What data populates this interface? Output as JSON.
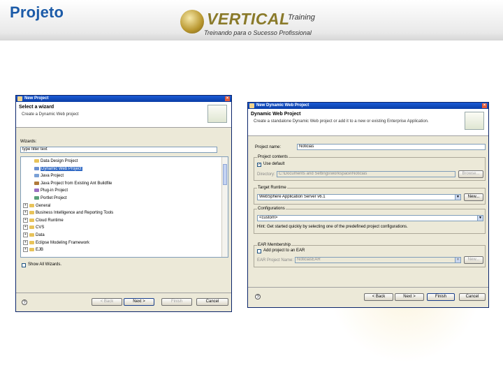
{
  "slide": {
    "title": "Projeto",
    "logo": {
      "brand": "ERTICAL",
      "brand_prefix": "V",
      "brand_suffix": "Training",
      "tagline": "Treinando para o Sucesso Profissional"
    }
  },
  "wizard": {
    "window_title": "New Project",
    "header_title": "Select a wizard",
    "header_desc": "Create a Dynamic Web project",
    "wizards_label": "Wizards:",
    "filter_value": "type filter text",
    "tree": [
      {
        "label": "Data Design Project",
        "level": 1,
        "icon": "folder-icon",
        "twisty": ""
      },
      {
        "label": "Dynamic Web Project",
        "level": 1,
        "icon": "web-project-icon",
        "twisty": "",
        "selected": true
      },
      {
        "label": "Java Project",
        "level": 1,
        "icon": "java-project-icon",
        "twisty": ""
      },
      {
        "label": "Java Project from Existing Ant Buildfile",
        "level": 1,
        "icon": "ant-icon",
        "twisty": ""
      },
      {
        "label": "Plug-in Project",
        "level": 1,
        "icon": "plugin-icon",
        "twisty": ""
      },
      {
        "label": "Portlet Project",
        "level": 1,
        "icon": "portlet-icon",
        "twisty": ""
      },
      {
        "label": "General",
        "level": 0,
        "icon": "folder-icon",
        "twisty": "+"
      },
      {
        "label": "Business Intelligence and Reporting Tools",
        "level": 0,
        "icon": "folder-icon",
        "twisty": "+"
      },
      {
        "label": "Cloud Runtime",
        "level": 0,
        "icon": "folder-icon",
        "twisty": "+"
      },
      {
        "label": "CVS",
        "level": 0,
        "icon": "folder-icon",
        "twisty": "+"
      },
      {
        "label": "Data",
        "level": 0,
        "icon": "folder-icon",
        "twisty": "+"
      },
      {
        "label": "Eclipse Modeling Framework",
        "level": 0,
        "icon": "folder-icon",
        "twisty": "+"
      },
      {
        "label": "EJB",
        "level": 0,
        "icon": "folder-icon",
        "twisty": "+"
      }
    ],
    "show_all_label": "Show All Wizards.",
    "buttons": {
      "back": "< Back",
      "next": "Next >",
      "finish": "Finish",
      "cancel": "Cancel"
    }
  },
  "dwp": {
    "window_title": "New Dynamic Web Project",
    "header_title": "Dynamic Web Project",
    "header_desc": "Create a standalone Dynamic Web project or add it to a new or existing Enterprise Application.",
    "project_name_label": "Project name:",
    "project_name_value": "Noticias",
    "contents_group": "Project contents",
    "use_default_label": "Use default",
    "directory_label": "Directory:",
    "directory_value": "C:\\Documents and Settings\\workspace\\Noticias",
    "browse_label": "Browse...",
    "runtime_group": "Target Runtime",
    "runtime_value": "WebSphere Application Server v6.1",
    "new_label": "New...",
    "config_group": "Configurations",
    "config_value": "<custom>",
    "config_hint": "Hint: Get started quickly by selecting one of the predefined project configurations.",
    "ear_group": "EAR Membership",
    "add_ear_label": "Add project to an EAR",
    "ear_project_label": "EAR Project Name:",
    "ear_project_value": "NoticiasEAR",
    "buttons": {
      "back": "< Back",
      "next": "Next >",
      "finish": "Finish",
      "cancel": "Cancel"
    }
  }
}
